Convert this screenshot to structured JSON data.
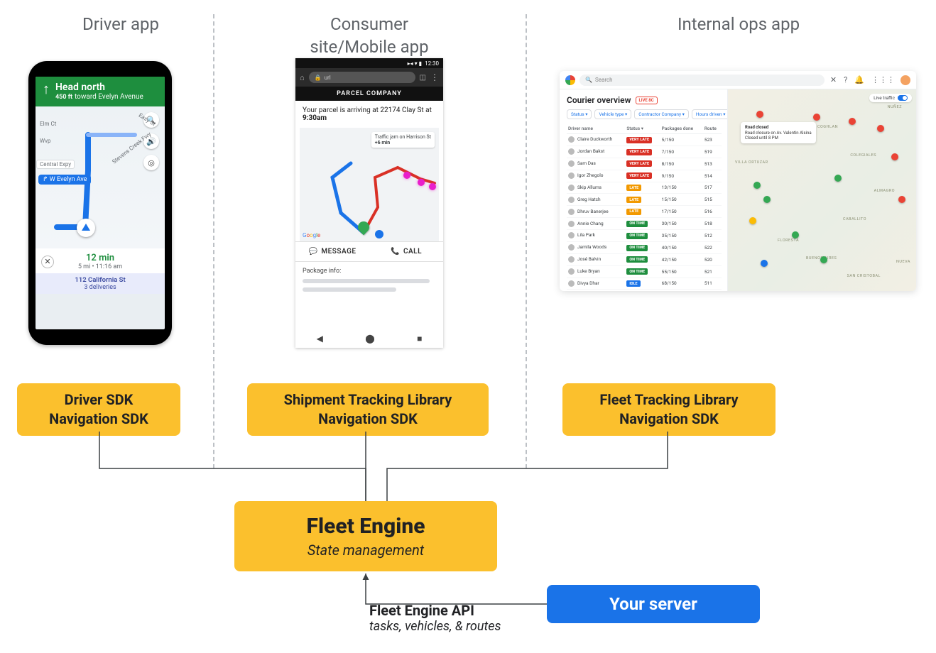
{
  "columns": {
    "driver": {
      "title": "Driver app"
    },
    "consumer": {
      "title_l1": "Consumer",
      "title_l2": "site/Mobile app"
    },
    "ops": {
      "title": "Internal ops app"
    }
  },
  "sdk_boxes": {
    "driver": {
      "line1": "Driver SDK",
      "line2": "Navigation SDK"
    },
    "consumer": {
      "line1": "Shipment Tracking Library",
      "line2": "Navigation SDK"
    },
    "ops": {
      "line1": "Fleet Tracking Library",
      "line2": "Navigation SDK"
    }
  },
  "engine": {
    "title": "Fleet Engine",
    "subtitle": "State management"
  },
  "server": {
    "label": "Your server"
  },
  "api_label": {
    "title": "Fleet Engine API",
    "subtitle": "tasks, vehicles, & routes"
  },
  "driver_app": {
    "nav_banner": {
      "direction": "Head north",
      "distance": "450 ft",
      "toward": "toward Evelyn Avenue"
    },
    "map_labels": {
      "elm": "Elm Ct",
      "wvp": "Wvp",
      "central": "Central Expy",
      "stevens": "Stevens Creek Fwy",
      "easy": "Easy St"
    },
    "route_chip": "↱ W Evelyn Ave",
    "eta": {
      "time": "12 min",
      "sub": "5 mi • 11:16 am"
    },
    "delivery": {
      "address": "112 California St",
      "count": "3 deliveries"
    }
  },
  "consumer_app": {
    "status_time": "12:30",
    "url_placeholder": "url",
    "header": "PARCEL COMPANY",
    "status_line_pre": "Your parcel is arriving at 22174 Clay St at",
    "status_line_time": "9:30am",
    "traffic_chip": {
      "l1": "Traffic jam on Harrison St",
      "l2": "+6 min"
    },
    "actions": {
      "message": "MESSAGE",
      "call": "CALL"
    },
    "package_info_label": "Package info:",
    "google_logo": "Google"
  },
  "ops_app": {
    "search_placeholder": "Search",
    "title": "Courier overview",
    "live_badge": "LIVE 8C",
    "filters": [
      "Status ▾",
      "Vehicle type ▾",
      "Contractor Company ▾",
      "Hours driven ▾"
    ],
    "columns": [
      "Driver name",
      "Status ▾",
      "Packages done",
      "Route"
    ],
    "rows": [
      {
        "name": "Claire Duckworth",
        "status": "VERY LATE",
        "status_cls": "st-verylate",
        "pkg": "5/150",
        "route": "523"
      },
      {
        "name": "Jordan Bakst",
        "status": "VERY LATE",
        "status_cls": "st-verylate",
        "pkg": "7/150",
        "route": "519"
      },
      {
        "name": "Sam Das",
        "status": "VERY LATE",
        "status_cls": "st-verylate",
        "pkg": "8/150",
        "route": "513"
      },
      {
        "name": "Igor Zhegolo",
        "status": "VERY LATE",
        "status_cls": "st-verylate",
        "pkg": "9/150",
        "route": "514"
      },
      {
        "name": "Skip Allums",
        "status": "LATE",
        "status_cls": "st-late",
        "pkg": "13/150",
        "route": "517"
      },
      {
        "name": "Greg Hatch",
        "status": "LATE",
        "status_cls": "st-late",
        "pkg": "15/150",
        "route": "515"
      },
      {
        "name": "Dhruv Banerjee",
        "status": "LATE",
        "status_cls": "st-late",
        "pkg": "17/150",
        "route": "516"
      },
      {
        "name": "Annie Chang",
        "status": "ON TIME",
        "status_cls": "st-ontime",
        "pkg": "30/150",
        "route": "518"
      },
      {
        "name": "Lila Park",
        "status": "ON TIME",
        "status_cls": "st-ontime",
        "pkg": "35/150",
        "route": "512"
      },
      {
        "name": "Jamila Woods",
        "status": "ON TIME",
        "status_cls": "st-ontime",
        "pkg": "40/150",
        "route": "522"
      },
      {
        "name": "José Balvin",
        "status": "ON TIME",
        "status_cls": "st-ontime",
        "pkg": "42/150",
        "route": "520"
      },
      {
        "name": "Luke Bryan",
        "status": "ON TIME",
        "status_cls": "st-ontime",
        "pkg": "55/150",
        "route": "521"
      },
      {
        "name": "Divya Dhar",
        "status": "IDLE",
        "status_cls": "st-idle",
        "pkg": "68/150",
        "route": "511"
      }
    ],
    "traffic_toggle": "Live traffic",
    "road_callout": {
      "heading": "Road closed",
      "l1": "Road closure on Av. Valentin Alsina",
      "l2": "Closed until 8 PM"
    },
    "areas": [
      "NUÑEZ",
      "COGHLAN",
      "COLEGIALES",
      "VILLA ORTUZAR",
      "ALMAGRO",
      "CABALLITO",
      "FLORESTA",
      "BUENOS AIRES",
      "NUEVA",
      "SAN CRISTOBAL"
    ]
  }
}
